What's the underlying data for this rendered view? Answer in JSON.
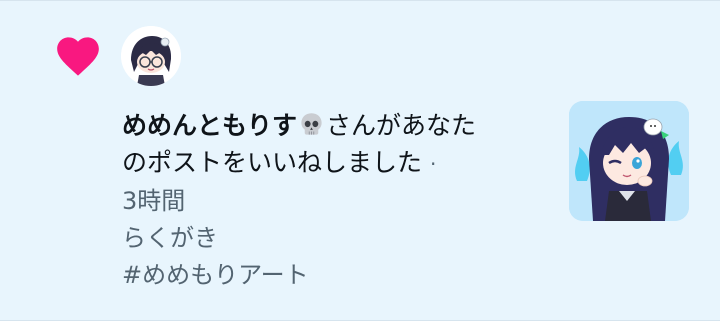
{
  "notification": {
    "type_icon": "heart-icon",
    "user_avatar_icon": "avatar-anime-girl",
    "user_name": "めめんともりす",
    "name_emoji_icon": "skull-icon",
    "message_line1": "さんがあなた",
    "message_line2": "のポストをいいねしました",
    "separator": "·",
    "time": "3時間",
    "post_text_line1": "らくがき",
    "post_text_line2": "#めめもりアート",
    "post_thumbnail_icon": "anime-girl-illustration"
  },
  "colors": {
    "background": "#e8f5fd",
    "heart": "#f91880",
    "text_primary": "#0f1419",
    "text_secondary": "#536471"
  }
}
